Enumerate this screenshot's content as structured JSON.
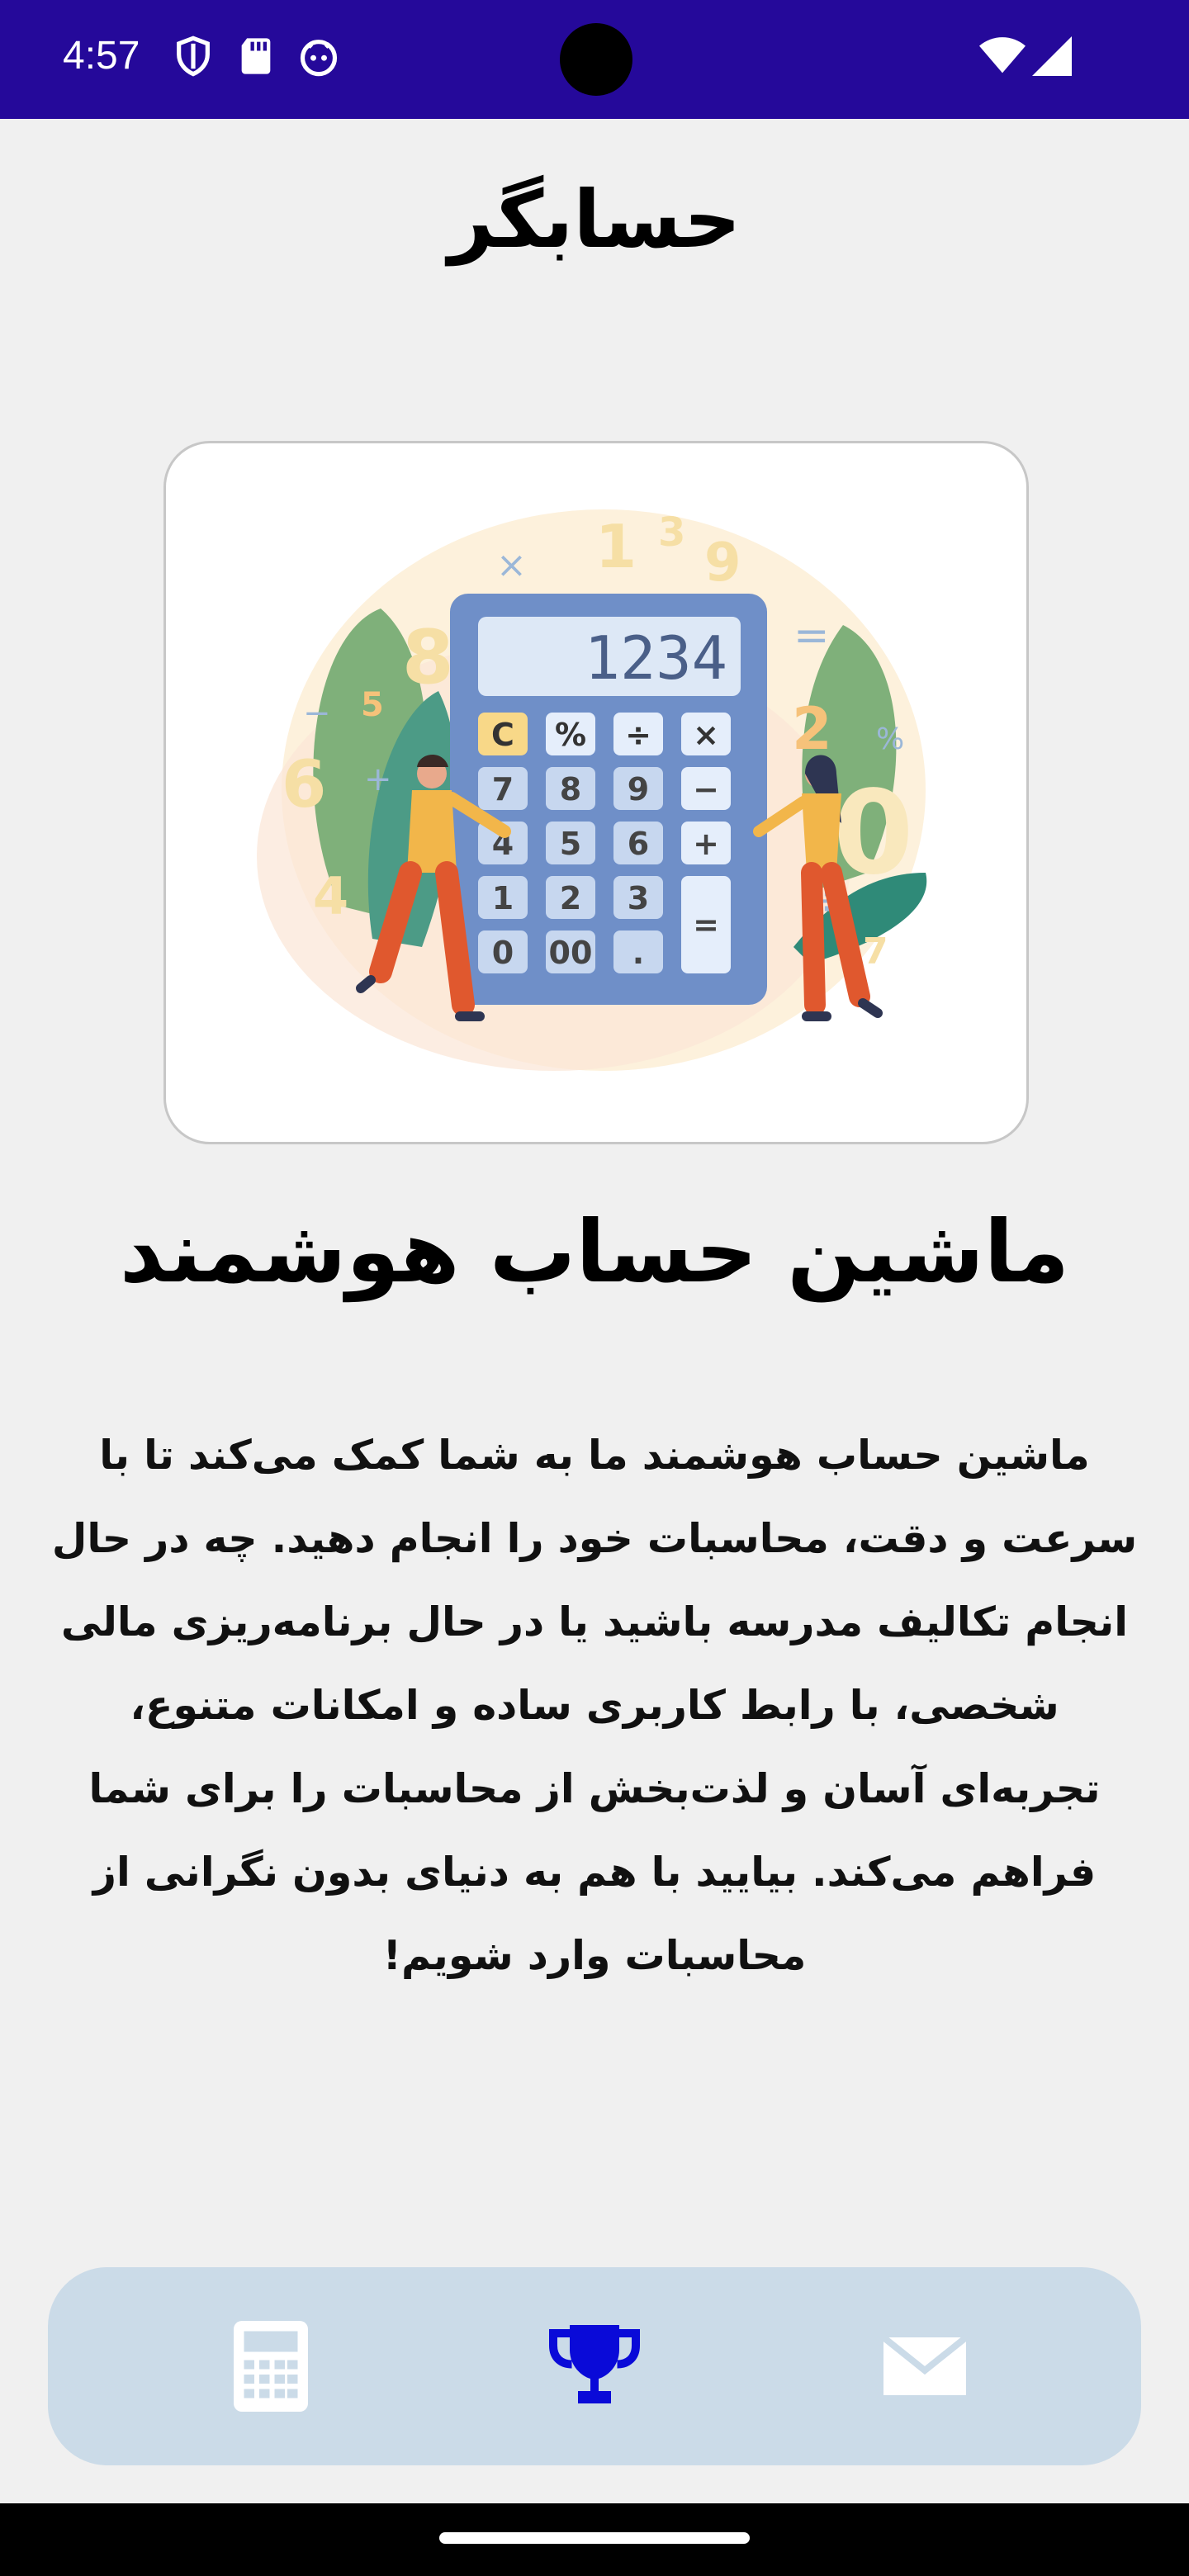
{
  "status_bar": {
    "time": "4:57",
    "icons": [
      "shield-icon",
      "sd-card-icon",
      "android-icon",
      "wifi-icon",
      "signal-icon"
    ],
    "background_color": "#25099a"
  },
  "header": {
    "title": "حسابگر"
  },
  "hero": {
    "image_name": "calculator-illustration",
    "calculator_display": "1234",
    "keypad": [
      "C",
      "%",
      "÷",
      "×",
      "7",
      "8",
      "9",
      "−",
      "4",
      "5",
      "6",
      "+",
      "1",
      "2",
      "3",
      "=",
      "0",
      "00",
      "."
    ]
  },
  "main": {
    "headline": "ماشین حساب هوشمند",
    "description": "ماشین حساب هوشمند ما به شما کمک می‌کند تا با سرعت و دقت، محاسبات خود را انجام دهید. چه در حال انجام تکالیف مدرسه باشید یا در حال برنامه‌ریزی مالی شخصی، با رابط کاربری ساده و امکانات متنوع، تجربه‌ای آسان و لذت‌بخش از محاسبات را برای شما فراهم می‌کند. بیایید با هم به دنیای بدون نگرانی از محاسبات وارد شویم!"
  },
  "bottom_nav": {
    "items": [
      {
        "icon": "calculator-icon",
        "active": false
      },
      {
        "icon": "trophy-icon",
        "active": true
      },
      {
        "icon": "envelope-icon",
        "active": false
      }
    ],
    "active_color": "#0a0ad8",
    "inactive_color": "#ffffff",
    "background_color": "#cbdbe8"
  }
}
